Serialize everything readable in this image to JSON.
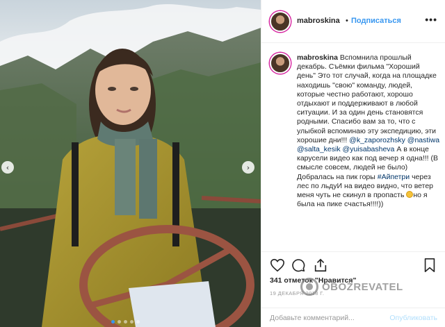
{
  "post": {
    "username": "mabroskina",
    "follow_separator": "•",
    "follow_label": "Подписаться",
    "more_icon": "more-horizontal-icon"
  },
  "caption": {
    "username": "mabroskina",
    "text_1": "Вспомнила прошлый декабрь. Съёмки фильма \"Хороший день\" Это тот случай, когда на площадке находишь \"свою\" команду, людей, которые честно работают, хорошо отдыхают и поддерживают в любой ситуации. И за один день становятся родными. Спасибо вам за то, что с улыбкой вспоминаю эту экспедицию, эти хорошие дни!!!",
    "tags": [
      "@k_zaporozhsky",
      "@nastiwa",
      "@salta_kesik",
      "@yuisabasheva"
    ],
    "text_2": "А в конце карусели видео как под вечер я одна!!! (В смысле совсем, людей не было) Добралась на пик горы",
    "hashtag": "#Айпетри",
    "text_3": "через лес по льдуИ на видео видно, что ветер меня чуть не скинул в пропасть",
    "text_4": "но я была на пике счастья!!!!))"
  },
  "actions": {
    "like_icon": "heart-icon",
    "comment_icon": "comment-bubble-icon",
    "share_icon": "share-icon",
    "save_icon": "bookmark-icon"
  },
  "likes": {
    "count": "341 отметок",
    "liked_label": "\"Нравится\""
  },
  "date": "19 ДЕКАБРЯ 2018 Г.",
  "comment_box": {
    "placeholder": "Добавьте комментарий...",
    "publish_label": "Опубликовать"
  },
  "carousel": {
    "prev_icon": "chevron-left-icon",
    "next_icon": "chevron-right-icon",
    "slides": 5,
    "active_slide": 1
  },
  "watermark": "OBOZREVATEL",
  "colors": {
    "accent": "#3897f0",
    "publish_disabled": "#b2dffc",
    "tag": "#003569",
    "border": "#efefef"
  }
}
